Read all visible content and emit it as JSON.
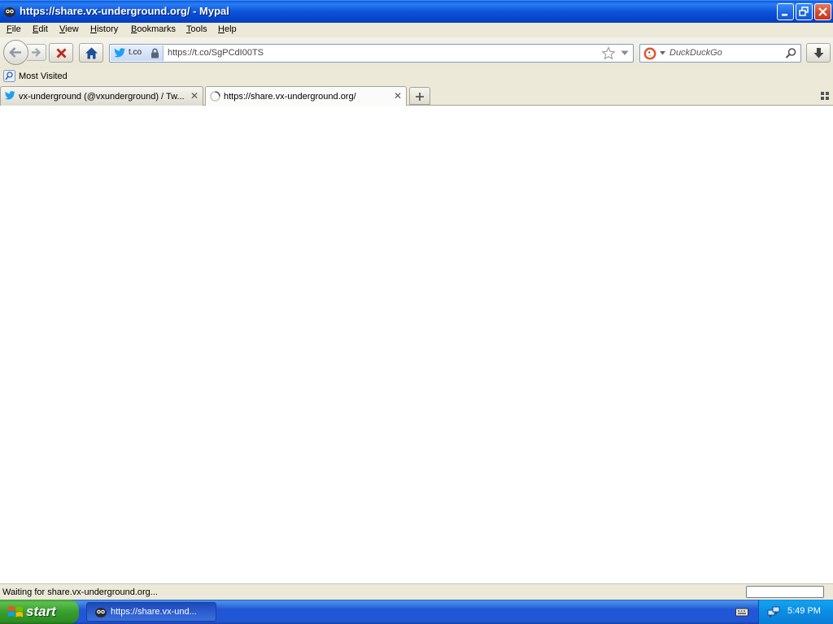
{
  "window": {
    "title": "https://share.vx-underground.org/ - Mypal"
  },
  "menu": {
    "items": [
      "File",
      "Edit",
      "View",
      "History",
      "Bookmarks",
      "Tools",
      "Help"
    ]
  },
  "urlbar": {
    "identity": "t.co",
    "url": "https://t.co/SgPCdI00TS"
  },
  "search": {
    "placeholder": "DuckDuckGo"
  },
  "bookmarks": {
    "most_visited": "Most Visited"
  },
  "tabs": [
    {
      "label": "vx-underground (@vxunderground) / Tw...",
      "icon": "twitter-icon"
    },
    {
      "label": "https://share.vx-underground.org/",
      "icon": "loading-icon"
    }
  ],
  "status": {
    "text": "Waiting for share.vx-underground.org..."
  },
  "taskbar": {
    "start_label": "start",
    "task_label": "https://share.vx-und...",
    "clock": "5:49 PM"
  },
  "colors": {
    "titlebar": "#0a54d9",
    "chrome": "#ece9d8",
    "taskbar": "#2157d7",
    "start_button": "#389e2f"
  }
}
